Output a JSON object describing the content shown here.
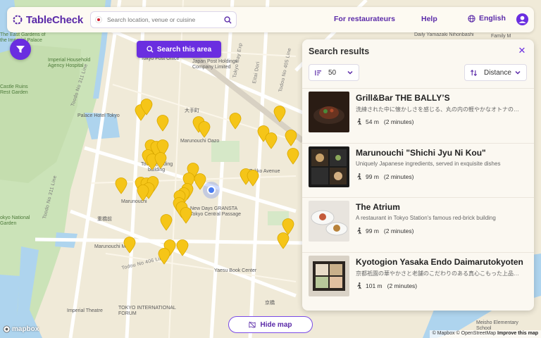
{
  "header": {
    "logo_text": "TableCheck",
    "search_placeholder": "Search location, venue or cuisine",
    "for_restaurateurs": "For restaurateurs",
    "help": "Help",
    "language": "English",
    "brand_color": "#5a2aa8"
  },
  "map": {
    "search_area_label": "Search this area",
    "hide_map_label": "Hide map",
    "mapbox_label": "mapbox",
    "attribution": {
      "mapbox": "© Mapbox",
      "osm": "© OpenStreetMap",
      "improve": "Improve this map"
    },
    "labels": {
      "east_garden": "The East Gardens of\nthe Imperial Palace",
      "imperial_household": "Imperial Household\nAgency Hospital",
      "castle_ruins": "Castle Ruins\nRest Garden",
      "palace_hotel": "Palace Hotel Tokyo",
      "otemachi": "大手町",
      "marunouchi_oazo": "Marunouchi Oazo",
      "tokyo_building": "Tokyo Building",
      "building": "building",
      "tekko": "Tekko Avenue",
      "new_days": "New Days GRANSTA\nTokyo Central Passage",
      "marunouchi_a": "Marunouchi",
      "yurakucho": "重橋前",
      "marunouchi_m": "Marunouchi M",
      "yaesu": "Yaesu Book Center",
      "kyobashi": "京橋",
      "imperial_theatre": "Imperial Theatre",
      "tif": "TOKYO INTERNATIONAL\nFORUM",
      "tokyo_garden": "okyo National\nGarden",
      "post": "Tokyo Post Office",
      "jp_holdings": "Japan Post Holdings\nCompany Limited",
      "daily_yamazaki": "Daily Yamazaki Nihonbashi",
      "family_mart": "Family M",
      "meisho": "Meisho Elementary\nSchool",
      "road_311_a": "Toodo No 311 Line",
      "road_311_b": "Toodo No 311 Line",
      "road_406": "Todou No 406 Line",
      "road_405": "Todou No 405 Line",
      "road_eitai": "Eitai Dori",
      "road_tbe": "Tokyo Bay Exp"
    }
  },
  "panel": {
    "title": "Search results",
    "page_size": "50",
    "sort": "Distance",
    "results": [
      {
        "name": "Grill&Bar THE BALLY’S",
        "desc": "洗練された中に懐かしさを感じる、丸の内の軽やかなオトナの…",
        "distance": "54 m",
        "time": "(2 minutes)"
      },
      {
        "name": "Marunouchi \"Shichi Jyu Ni Kou\"",
        "desc": "Uniquely Japanese ingredients, served in exquisite dishes",
        "distance": "99 m",
        "time": "(2 minutes)"
      },
      {
        "name": "The Atrium",
        "desc": "A restaurant in Tokyo Station's famous red-brick building",
        "distance": "99 m",
        "time": "(2 minutes)"
      },
      {
        "name": "Kyotogion Yasaka Endo Daimarutokyoten",
        "desc": "京都祇園の華やかさと老舗のこだわりのある真心こもった上品…",
        "distance": "101 m",
        "time": "(2 minutes)"
      }
    ]
  }
}
